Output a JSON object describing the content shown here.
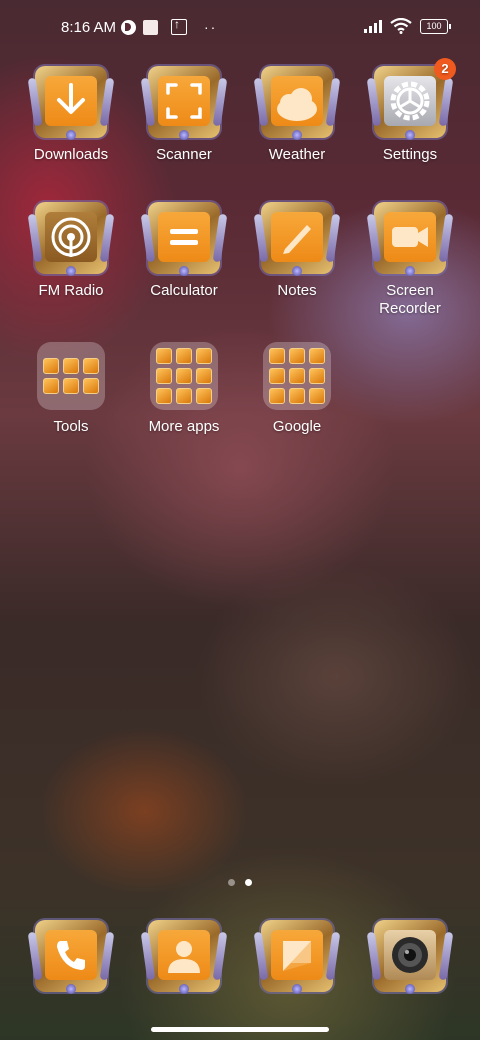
{
  "status_bar": {
    "time": "8:16 AM",
    "battery": "100",
    "icons": [
      "data-saver-icon",
      "notification-square-icon",
      "upload-icon",
      "more-dots-icon",
      "signal-icon",
      "wifi-icon",
      "battery-icon"
    ]
  },
  "apps": [
    {
      "label": "Downloads",
      "icon": "download-arrow-icon",
      "badge": ""
    },
    {
      "label": "Scanner",
      "icon": "scanner-frame-icon",
      "badge": ""
    },
    {
      "label": "Weather",
      "icon": "weather-cloud-icon",
      "badge": ""
    },
    {
      "label": "Settings",
      "icon": "gear-icon",
      "badge": "2"
    },
    {
      "label": "FM Radio",
      "icon": "radio-antenna-icon",
      "badge": ""
    },
    {
      "label": "Calculator",
      "icon": "equals-icon",
      "badge": ""
    },
    {
      "label": "Notes",
      "icon": "pencil-icon",
      "badge": ""
    },
    {
      "label": "Screen Recorder",
      "icon": "video-camera-icon",
      "badge": ""
    }
  ],
  "folders": [
    {
      "label": "Tools",
      "icon": "folder-icon"
    },
    {
      "label": "More apps",
      "icon": "folder-icon"
    },
    {
      "label": "Google",
      "icon": "folder-icon"
    }
  ],
  "dock": [
    {
      "name": "phone",
      "icon": "phone-icon"
    },
    {
      "name": "contacts",
      "icon": "contact-person-icon"
    },
    {
      "name": "messages",
      "icon": "message-icon"
    },
    {
      "name": "camera",
      "icon": "camera-lens-icon"
    }
  ],
  "pager": {
    "pages": 2,
    "current": 2
  }
}
